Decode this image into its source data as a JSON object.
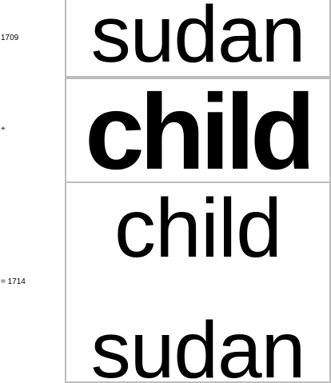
{
  "equation": {
    "operand_a": {
      "label": "1709",
      "word": "sudan"
    },
    "operator": "+",
    "operand_b": {
      "word": "child"
    },
    "result": {
      "label": "=  1714",
      "word_top": "child",
      "word_bottom": "sudan"
    }
  }
}
